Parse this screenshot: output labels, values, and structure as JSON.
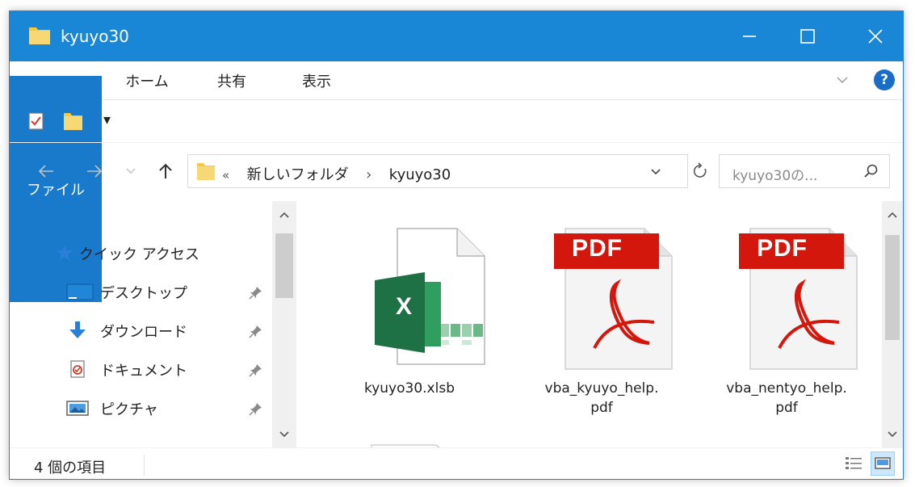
{
  "window": {
    "title": "kyuyo30",
    "minimize_icon": "minimize-icon",
    "maximize_icon": "maximize-icon",
    "close_icon": "close-icon"
  },
  "ribbon": {
    "tabs": [
      {
        "label": "ファイル",
        "active": true
      },
      {
        "label": "ホーム"
      },
      {
        "label": "共有"
      },
      {
        "label": "表示"
      }
    ],
    "expand_icon": "chevron-down-icon",
    "help_label": "?"
  },
  "qat": {
    "items": [
      "properties-icon",
      "new-folder-icon",
      "customize-qat-icon"
    ],
    "customize_glyph": "▾"
  },
  "address": {
    "back_icon": "back-arrow-icon",
    "forward_icon": "forward-arrow-icon",
    "recent_icon": "chevron-down-icon",
    "up_icon": "up-arrow-icon",
    "overflow": "«",
    "crumbs": [
      "新しいフォルダ",
      "kyuyo30"
    ],
    "separator": "›",
    "search_placeholder": "kyuyo30の..."
  },
  "nav": {
    "items": [
      {
        "label": "クイック アクセス",
        "icon": "star-icon"
      },
      {
        "label": "デスクトップ",
        "icon": "desktop-icon",
        "pinned": true
      },
      {
        "label": "ダウンロード",
        "icon": "download-icon",
        "pinned": true
      },
      {
        "label": "ドキュメント",
        "icon": "documents-icon",
        "pinned": true
      },
      {
        "label": "ピクチャ",
        "icon": "pictures-icon",
        "pinned": true
      }
    ]
  },
  "files": [
    {
      "name": "kyuyo30.xlsb",
      "icon": "excel-file-icon",
      "badge": "X"
    },
    {
      "name": "vba_kyuyo_help.\npdf",
      "icon": "pdf-file-icon",
      "badge": "PDF"
    },
    {
      "name": "vba_nentyo_help.\npdf",
      "icon": "pdf-file-icon",
      "badge": "PDF"
    }
  ],
  "status": {
    "text": "4 個の項目",
    "details_view_icon": "details-view-icon",
    "large_icons_view_icon": "large-icons-view-icon"
  },
  "colors": {
    "title_bar": "#1a86d6",
    "file_tab": "#1979ca",
    "excel_green": "#1e7145",
    "pdf_red": "#d4170d"
  }
}
